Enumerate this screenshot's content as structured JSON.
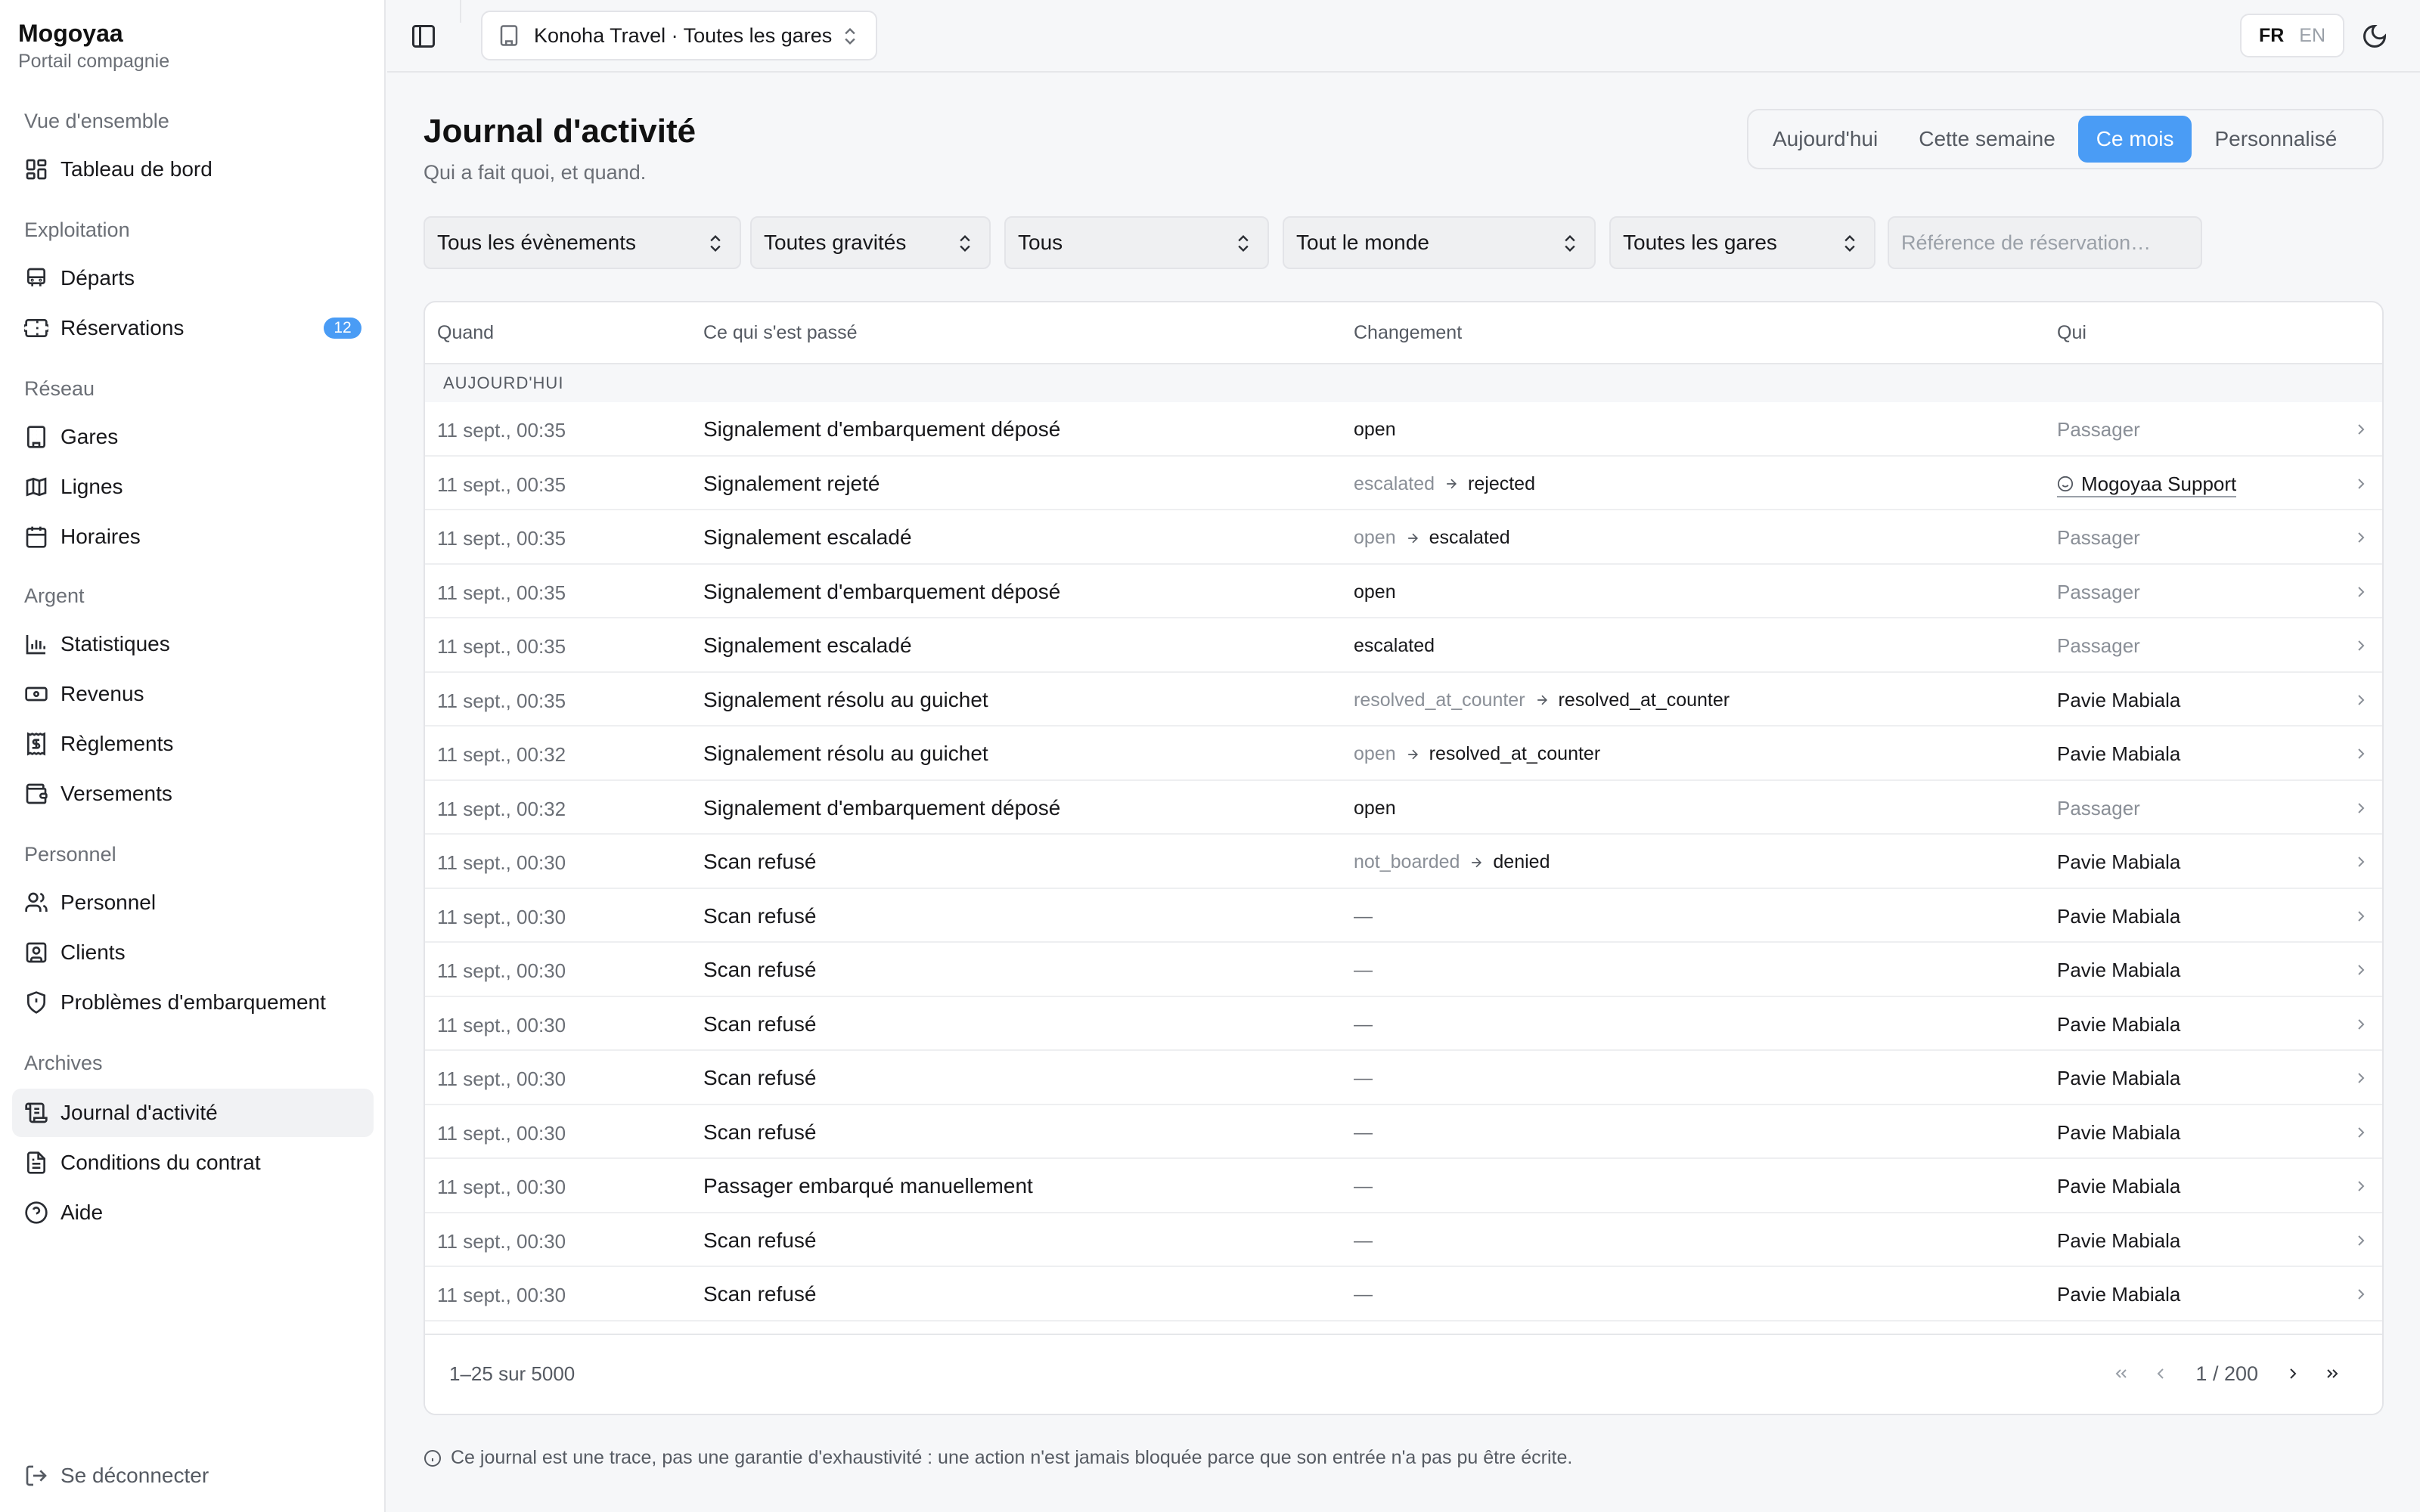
{
  "brand": {
    "name": "Mogoyaa",
    "subtitle": "Portail compagnie"
  },
  "sidebar": {
    "groups": [
      {
        "title": "Vue d'ensemble",
        "items": [
          {
            "label": "Tableau de bord",
            "icon": "dashboard-icon"
          }
        ]
      },
      {
        "title": "Exploitation",
        "items": [
          {
            "label": "Départs",
            "icon": "bus-icon"
          },
          {
            "label": "Réservations",
            "icon": "ticket-icon",
            "badge": "12"
          }
        ]
      },
      {
        "title": "Réseau",
        "items": [
          {
            "label": "Gares",
            "icon": "building-icon"
          },
          {
            "label": "Lignes",
            "icon": "map-icon"
          },
          {
            "label": "Horaires",
            "icon": "calendar-icon"
          }
        ]
      },
      {
        "title": "Argent",
        "items": [
          {
            "label": "Statistiques",
            "icon": "bar-chart-icon"
          },
          {
            "label": "Revenus",
            "icon": "banknote-icon"
          },
          {
            "label": "Règlements",
            "icon": "receipt-icon"
          },
          {
            "label": "Versements",
            "icon": "wallet-icon"
          }
        ]
      },
      {
        "title": "Personnel",
        "items": [
          {
            "label": "Personnel",
            "icon": "users-icon"
          },
          {
            "label": "Clients",
            "icon": "contact-icon"
          },
          {
            "label": "Problèmes d'embarquement",
            "icon": "shield-alert-icon"
          }
        ]
      },
      {
        "title": "Archives",
        "items": [
          {
            "label": "Journal d'activité",
            "icon": "scroll-icon",
            "active": true
          },
          {
            "label": "Conditions du contrat",
            "icon": "file-text-icon"
          },
          {
            "label": "Aide",
            "icon": "help-circle-icon"
          }
        ]
      }
    ],
    "logout_label": "Se déconnecter"
  },
  "topbar": {
    "company_selector": "Konoha Travel · Toutes les gares",
    "lang_active": "FR",
    "lang_inactive": "EN"
  },
  "page": {
    "title": "Journal d'activité",
    "subtitle": "Qui a fait quoi, et quand.",
    "range_tabs": [
      "Aujourd'hui",
      "Cette semaine",
      "Ce mois",
      "Personnalisé"
    ],
    "range_active": "Ce mois"
  },
  "filters": {
    "events": "Tous les évènements",
    "severity": "Toutes gravités",
    "actor_type": "Tous",
    "people": "Tout le monde",
    "stations": "Toutes les gares",
    "search_placeholder": "Référence de réservation…"
  },
  "table": {
    "headers": {
      "when": "Quand",
      "what": "Ce qui s'est passé",
      "change": "Changement",
      "who": "Qui"
    },
    "group_label": "AUJOURD'HUI",
    "rows": [
      {
        "when": "11 sept., 00:35",
        "what": "Signalement d'embarquement déposé",
        "from": "",
        "to": "open",
        "who": "Passager",
        "who_type": "passenger"
      },
      {
        "when": "11 sept., 00:35",
        "what": "Signalement rejeté",
        "from": "escalated",
        "to": "rejected",
        "who": "Mogoyaa Support",
        "who_type": "support"
      },
      {
        "when": "11 sept., 00:35",
        "what": "Signalement escaladé",
        "from": "open",
        "to": "escalated",
        "who": "Passager",
        "who_type": "passenger"
      },
      {
        "when": "11 sept., 00:35",
        "what": "Signalement d'embarquement déposé",
        "from": "",
        "to": "open",
        "who": "Passager",
        "who_type": "passenger"
      },
      {
        "when": "11 sept., 00:35",
        "what": "Signalement escaladé",
        "from": "",
        "to": "escalated",
        "who": "Passager",
        "who_type": "passenger"
      },
      {
        "when": "11 sept., 00:35",
        "what": "Signalement résolu au guichet",
        "from": "resolved_at_counter",
        "to": "resolved_at_counter",
        "who": "Pavie Mabiala",
        "who_type": "staff"
      },
      {
        "when": "11 sept., 00:32",
        "what": "Signalement résolu au guichet",
        "from": "open",
        "to": "resolved_at_counter",
        "who": "Pavie Mabiala",
        "who_type": "staff"
      },
      {
        "when": "11 sept., 00:32",
        "what": "Signalement d'embarquement déposé",
        "from": "",
        "to": "open",
        "who": "Passager",
        "who_type": "passenger"
      },
      {
        "when": "11 sept., 00:30",
        "what": "Scan refusé",
        "from": "not_boarded",
        "to": "denied",
        "who": "Pavie Mabiala",
        "who_type": "staff"
      },
      {
        "when": "11 sept., 00:30",
        "what": "Scan refusé",
        "from": "",
        "to": "—",
        "who": "Pavie Mabiala",
        "who_type": "staff"
      },
      {
        "when": "11 sept., 00:30",
        "what": "Scan refusé",
        "from": "",
        "to": "—",
        "who": "Pavie Mabiala",
        "who_type": "staff"
      },
      {
        "when": "11 sept., 00:30",
        "what": "Scan refusé",
        "from": "",
        "to": "—",
        "who": "Pavie Mabiala",
        "who_type": "staff"
      },
      {
        "when": "11 sept., 00:30",
        "what": "Scan refusé",
        "from": "",
        "to": "—",
        "who": "Pavie Mabiala",
        "who_type": "staff"
      },
      {
        "when": "11 sept., 00:30",
        "what": "Scan refusé",
        "from": "",
        "to": "—",
        "who": "Pavie Mabiala",
        "who_type": "staff"
      },
      {
        "when": "11 sept., 00:30",
        "what": "Passager embarqué manuellement",
        "from": "",
        "to": "—",
        "who": "Pavie Mabiala",
        "who_type": "staff"
      },
      {
        "when": "11 sept., 00:30",
        "what": "Scan refusé",
        "from": "",
        "to": "—",
        "who": "Pavie Mabiala",
        "who_type": "staff"
      },
      {
        "when": "11 sept., 00:30",
        "what": "Scan refusé",
        "from": "",
        "to": "—",
        "who": "Pavie Mabiala",
        "who_type": "staff"
      }
    ],
    "footer": {
      "count": "1–25 sur 5000",
      "page": "1 / 200"
    }
  },
  "footnote": "Ce journal est une trace, pas une garantie d'exhaustivité : une action n'est jamais bloquée parce que son entrée n'a pas pu être écrite.",
  "colors": {
    "accent": "#4a9cf5",
    "sidebar_bg": "#ffffff",
    "page_bg": "#f6f7f9"
  }
}
